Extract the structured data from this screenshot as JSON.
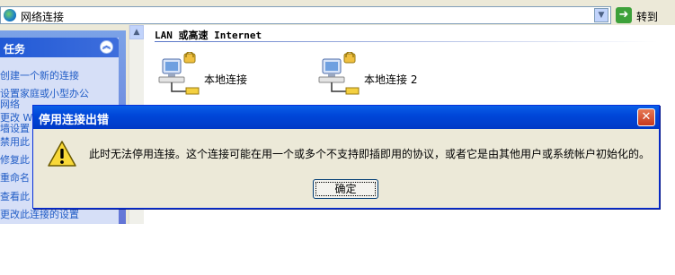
{
  "address_bar": {
    "value": "网络连接",
    "go_label": "转到"
  },
  "sidebar": {
    "header": "任务",
    "items": [
      "创建一个新的连接",
      "设置家庭或小型办公",
      "网络",
      "更改 W",
      "墙设置",
      "禁用此",
      "修复此",
      "重命名",
      "查看此",
      "更改此连接的设置"
    ]
  },
  "content": {
    "group_header": "LAN 或高速 Internet",
    "connections": [
      {
        "label": "本地连接"
      },
      {
        "label": "本地连接 2"
      }
    ]
  },
  "dialog": {
    "title": "停用连接出错",
    "message": "此时无法停用连接。这个连接可能在用一个或多个不支持即插即用的协议，或者它是由其他用户或系统帐户初始化的。",
    "ok_label": "确定"
  }
}
